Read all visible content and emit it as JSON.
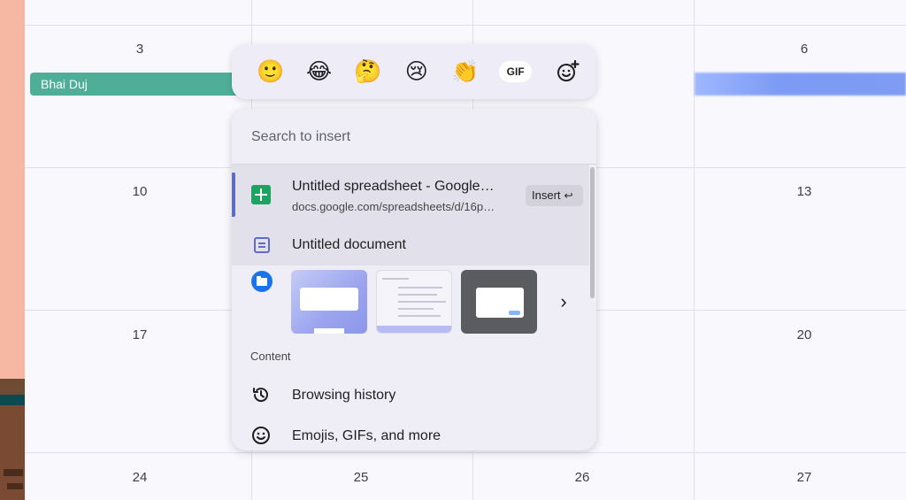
{
  "calendar": {
    "days": [
      "3",
      "6",
      "10",
      "13",
      "17",
      "20",
      "24",
      "25",
      "26",
      "27"
    ],
    "events": [
      {
        "title": "Bhai Duj",
        "color": "#4fae98"
      }
    ]
  },
  "emoji_bar": {
    "emojis": [
      "🙂",
      "😂",
      "🤔",
      "😢",
      "👏"
    ],
    "gif_label": "GIF",
    "add_icon": "add-emoji-icon"
  },
  "panel": {
    "search_placeholder": "Search to insert",
    "items": [
      {
        "title": "Untitled spreadsheet - Google…",
        "subtitle": "docs.google.com/spreadsheets/d/16p…",
        "icon": "google-sheets-icon",
        "action": "Insert",
        "action_key": "↩"
      },
      {
        "title": "Untitled document",
        "icon": "google-docs-icon"
      }
    ],
    "screenshots_icon": "folder-icon",
    "next_icon": "chevron-right-icon",
    "section_label": "Content",
    "content_items": [
      {
        "label": "Browsing history",
        "icon": "history-icon"
      },
      {
        "label": "Emojis, GIFs, and more",
        "icon": "smiley-icon"
      }
    ]
  },
  "colors": {
    "accent": "#5d6bc4",
    "sheets_green": "#1ea362",
    "event_teal": "#4fae98",
    "blurred_event": "#7f9cf3"
  }
}
